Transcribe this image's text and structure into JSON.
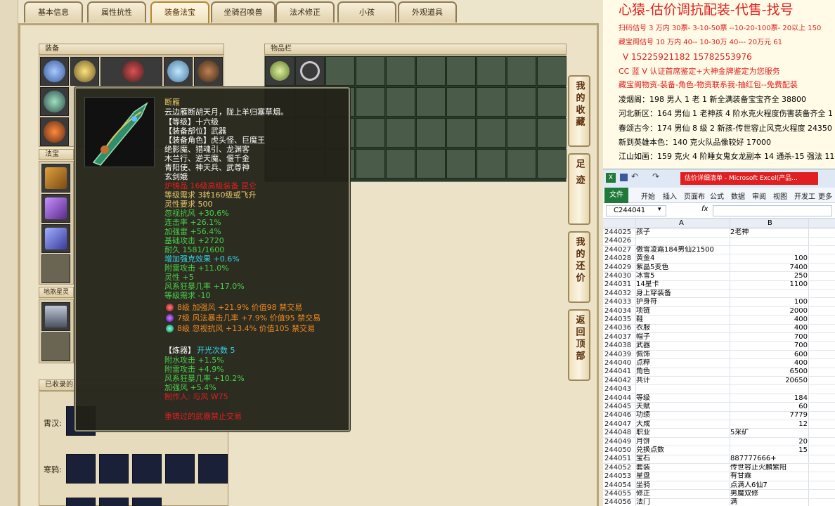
{
  "tabs": [
    "基本信息",
    "属性抗性",
    "装备法宝",
    "坐骑召唤兽",
    "法术修正",
    "小孩",
    "外观道具"
  ],
  "active_tab": 2,
  "panels": {
    "equipment_title": "装备",
    "inventory_title": "物品栏",
    "fabao_title": "法宝",
    "jingling_title": "地煞星灵",
    "mounts_title": "已收录的"
  },
  "side_buttons": [
    {
      "label": "我的收藏"
    },
    {
      "label": "足迹"
    },
    {
      "label": "我的还价"
    },
    {
      "label": "返回顶部"
    }
  ],
  "mount_rows": [
    {
      "label": "霄汉:"
    },
    {
      "label": "寒鸦:"
    }
  ],
  "tooltip": {
    "name": "断雁",
    "desc": "云边雁断胡天月，陇上羊归塞草烟。",
    "level": "【等级】十六级",
    "part": "【装备部位】武器",
    "roles_head": "【装备角色】虎头怪、巨魔王",
    "roles_l2": "绝影魔、猎魂引、龙渊客",
    "roles_l3": "木兰行、逆天魔、偃千金",
    "roles_l4": "青阳使、神天兵、武尊神",
    "roles_l5": "玄剑娥",
    "craft": "炉铸品 16级高级装备 昆仑",
    "req": "等级需求 3转160级或飞升",
    "spirit": "灵性要求 500",
    "stat1": "忽视抗风 +30.6%",
    "stat2": "连击率 +26.1%",
    "stat3": "加强雷 +56.4%",
    "stat4": "基础攻击 +2720",
    "dura": "耐久 1581/1600",
    "bonus1": "增加强克效果 +0.6%",
    "bonus2": "附雷攻击 +11.0%",
    "bonus3": "灵性 +5",
    "bonus4": "风系狂暴几率 +17.0%",
    "bonus5": "等级需求 -10",
    "gem1": "8级 加强风 +21.9% 价值98 禁交易",
    "gem2": "7级 风法暴击几率 +7.9% 价值95 禁交易",
    "gem3": "8级 忽视抗风 +13.4% 价值105 禁交易",
    "refine_label": "【炼器】",
    "refine_count": "开光次数 5",
    "ref1": "附水攻击 +1.5%",
    "ref2": "附雷攻击 +4.9%",
    "ref3": "风系狂暴几率 +10.2%",
    "ref4": "加强风 +5.4%",
    "maker": "制作人: 与风 W75",
    "warning": "重铸过的武器禁止交易"
  },
  "notes": {
    "title": "心猿-估价调抗配装-代售-找号",
    "l1": "扫码估号 3 万内 30票- 3-10-50票  --10-20-100票- 20以上 150",
    "l2": "藏宝阁估号 10 万内 40-- 10-30万 40--- 20万元 61",
    "l3": "V 15225921182    15782553976",
    "l4": "CC 蓝 V 认证首席鉴定+大神金牌鉴定为您服务",
    "l5": "藏宝阁物资-装备-角色-物资联系我-抽红包--免费配装",
    "l6": "凌烟阁：198 男人 1 老 1 新全满装备宝宝齐全 38800",
    "l7": "河北新区：164 男仙 1 老神孩 4 阶水克火程度伤害装备齐全 1",
    "l8": "春颂古今：174 男仙 8 级 2 新孩-传世容止风克火程度 24350",
    "l9": "新到英雄本色：140 克火队品像较好 17000",
    "l10": "江山如画：159 克火 4 阶睡女鬼女龙副本 14 通杀-15 强法 113"
  },
  "excel": {
    "title": "估价详细清单 - Microsoft Excel(产品...",
    "ribbon": [
      "文件",
      "开始",
      "插入",
      "页面布",
      "公式",
      "数据",
      "审阅",
      "视图",
      "开发工",
      "更多"
    ],
    "cell_ref": "C244041",
    "fx": "fx",
    "col_a": "A",
    "col_b": "B",
    "rows": [
      {
        "n": "244025",
        "a": "孩子",
        "b": "2老神",
        "num": false
      },
      {
        "n": "244026",
        "a": "",
        "b": "",
        "num": false
      },
      {
        "n": "244027",
        "a": "傲雪凌霜184男仙21500",
        "b": "",
        "num": false
      },
      {
        "n": "244028",
        "a": "黄金4",
        "b": "100",
        "num": true
      },
      {
        "n": "244029",
        "a": "紫晶5变色",
        "b": "7400",
        "num": true
      },
      {
        "n": "244030",
        "a": "冰雪5",
        "b": "250",
        "num": true
      },
      {
        "n": "244031",
        "a": "14星卡",
        "b": "1100",
        "num": true
      },
      {
        "n": "244032",
        "a": "身上穿装备",
        "b": "",
        "num": false
      },
      {
        "n": "244033",
        "a": "护身符",
        "b": "100",
        "num": true
      },
      {
        "n": "244034",
        "a": "项链",
        "b": "2000",
        "num": true
      },
      {
        "n": "244035",
        "a": "鞋",
        "b": "400",
        "num": true
      },
      {
        "n": "244036",
        "a": "衣服",
        "b": "400",
        "num": true
      },
      {
        "n": "244037",
        "a": "帽子",
        "b": "700",
        "num": true
      },
      {
        "n": "244038",
        "a": "武器",
        "b": "700",
        "num": true
      },
      {
        "n": "244039",
        "a": "佩饰",
        "b": "600",
        "num": true
      },
      {
        "n": "244040",
        "a": "点粹",
        "b": "400",
        "num": true
      },
      {
        "n": "244041",
        "a": "角色",
        "b": "6500",
        "num": true
      },
      {
        "n": "244042",
        "a": "共计",
        "b": "20650",
        "num": true
      },
      {
        "n": "244043",
        "a": "",
        "b": "",
        "num": false
      },
      {
        "n": "244044",
        "a": "等级",
        "b": "184",
        "num": true
      },
      {
        "n": "244045",
        "a": "天赋",
        "b": "60",
        "num": true
      },
      {
        "n": "244046",
        "a": "功绩",
        "b": "7779",
        "num": true
      },
      {
        "n": "244047",
        "a": "大成",
        "b": "12",
        "num": true
      },
      {
        "n": "244048",
        "a": "职业",
        "b": "5采矿",
        "num": false
      },
      {
        "n": "244049",
        "a": "月饼",
        "b": "20",
        "num": true
      },
      {
        "n": "244050",
        "a": "兑换点数",
        "b": "15",
        "num": true
      },
      {
        "n": "244051",
        "a": "宝石",
        "b": "887777666+",
        "num": false
      },
      {
        "n": "244052",
        "a": "套装",
        "b": "传世容止火麟紫阳",
        "num": false
      },
      {
        "n": "244053",
        "a": "星盘",
        "b": "有甘霖",
        "num": false
      },
      {
        "n": "244054",
        "a": "坐骑",
        "b": "点满人6仙7",
        "num": false
      },
      {
        "n": "244055",
        "a": "修正",
        "b": "男魔双修",
        "num": false
      },
      {
        "n": "244056",
        "a": "法门",
        "b": "满",
        "num": false
      }
    ]
  },
  "colors": {
    "red": "#e02020",
    "gold": "#e8c86a",
    "green": "#4ad04a",
    "cyan": "#33d6e6",
    "orange": "#f08a20"
  }
}
